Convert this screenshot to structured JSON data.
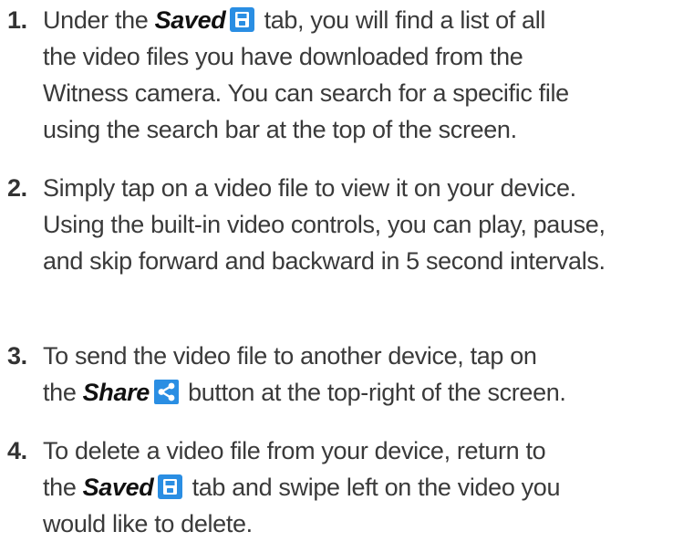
{
  "steps": [
    {
      "number": "1.",
      "line1_before": "Under the",
      "line1_em": "Saved",
      "line1_after": "tab, you will find a list of all",
      "line2": "the video files you have downloaded from the",
      "line3": "Witness camera. You can search for a specific file",
      "line4": "using the search bar at the top of the screen."
    },
    {
      "number": "2.",
      "line1": "Simply tap on a video file to view it on your device.",
      "line2": "Using the built-in video controls, you can play, pause,",
      "line3": "and skip forward and backward in 5 second intervals."
    },
    {
      "number": "3.",
      "line1": "To send the video file to another device, tap on",
      "line2_before": "the",
      "line2_em": "Share",
      "line2_after": "button at the top-right of the screen."
    },
    {
      "number": "4.",
      "line1": "To delete a video file from your device, return to",
      "line2_before": "the",
      "line2_em": "Saved",
      "line2_after": "tab and swipe left on the video you",
      "line3": "would like to delete."
    }
  ],
  "icons": {
    "saved": "save-icon",
    "share": "share-icon",
    "accent_color": "#2a8ee3"
  }
}
